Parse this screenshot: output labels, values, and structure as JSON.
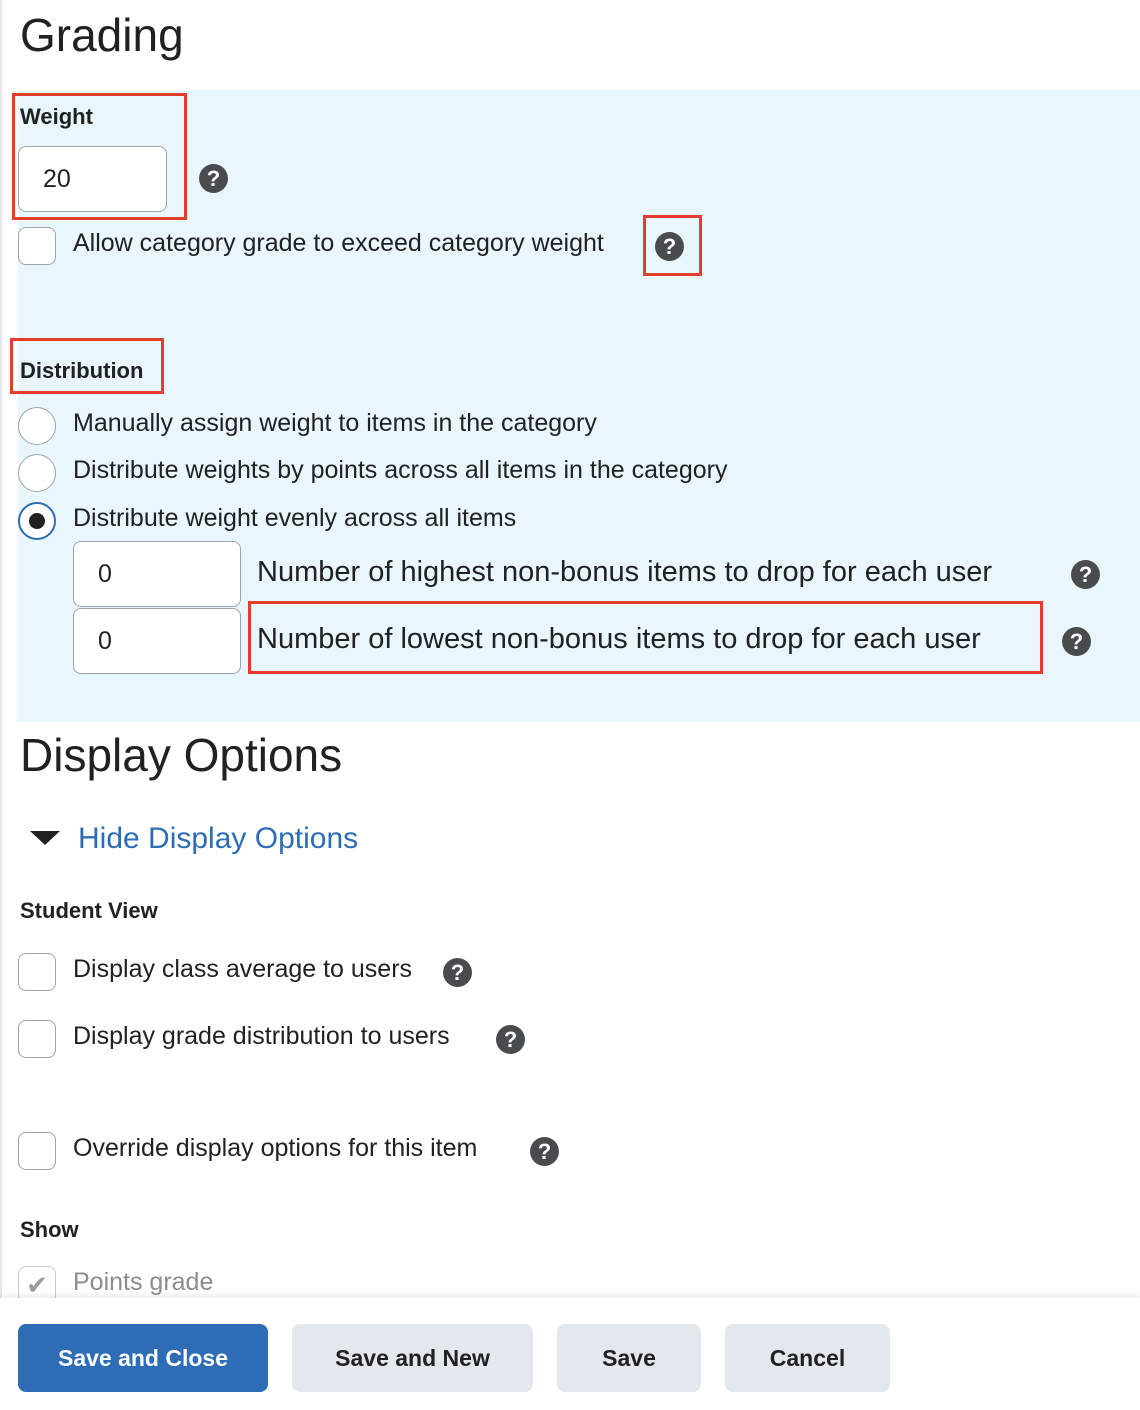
{
  "grading": {
    "title": "Grading",
    "weight_label": "Weight",
    "weight_value": "20",
    "exceed_label": "Allow category grade to exceed category weight",
    "exceed_checked": false,
    "distribution_label": "Distribution",
    "distribution_options": [
      {
        "label": "Manually assign weight to items in the category",
        "selected": false
      },
      {
        "label": "Distribute weights by points across all items in the category",
        "selected": false
      },
      {
        "label": "Distribute weight evenly across all items",
        "selected": true
      }
    ],
    "drop_highest_value": "0",
    "drop_highest_label": "Number of highest non-bonus items to drop for each user",
    "drop_lowest_value": "0",
    "drop_lowest_label": "Number of lowest non-bonus items to drop for each user",
    "help_glyph": "?"
  },
  "display": {
    "title": "Display Options",
    "toggle_label": "Hide Display Options",
    "student_view_label": "Student View",
    "class_average_label": "Display class average to users",
    "grade_distribution_label": "Display grade distribution to users",
    "override_label": "Override display options for this item",
    "show_label": "Show",
    "points_grade_label": "Points grade"
  },
  "footer": {
    "save_close": "Save and Close",
    "save_new": "Save and New",
    "save": "Save",
    "cancel": "Cancel"
  },
  "colors": {
    "accent": "#2e6db6",
    "highlight": "#e43d2d",
    "panel": "#e9f6fe"
  },
  "icons": {
    "help": "question-circle-icon",
    "toggle": "caret-down-icon",
    "check": "checkmark-icon"
  }
}
